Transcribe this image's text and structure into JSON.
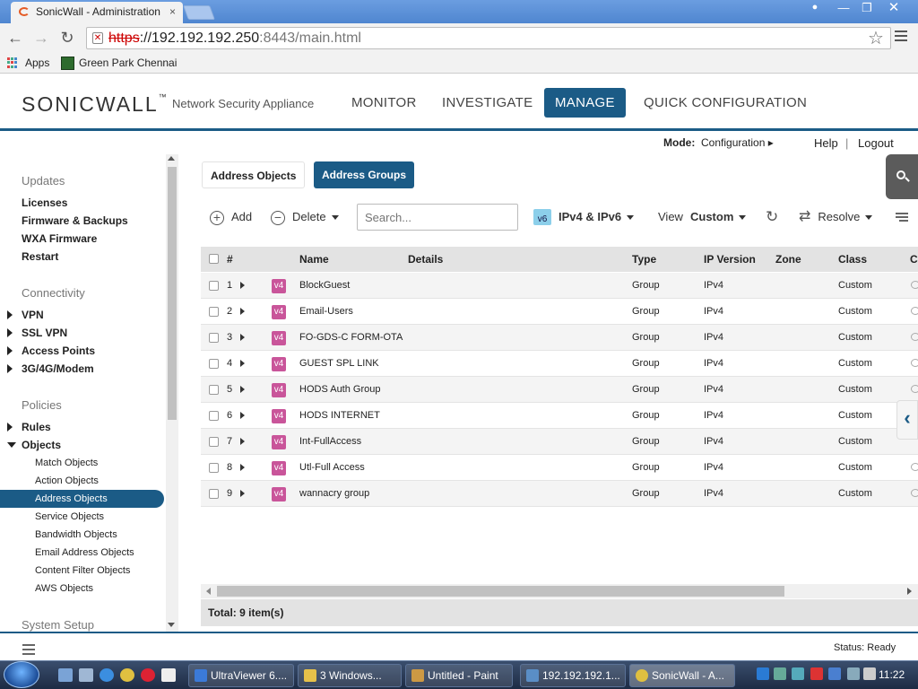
{
  "browser": {
    "tab_title": "SonicWall - Administration",
    "tab_close": "×",
    "url_scheme": "https",
    "url_host": "://192.192.192.250",
    "url_path": ":8443/main.html",
    "bookmarks": [
      {
        "label": "Apps",
        "icon": "apps-grid-icon"
      },
      {
        "label": "Green Park Chennai",
        "icon": "bookmark-favicon"
      }
    ]
  },
  "header": {
    "logo_text": "SONICWALL",
    "logo_tm": "™",
    "tagline": "Network Security Appliance",
    "nav": [
      "MONITOR",
      "INVESTIGATE",
      "MANAGE",
      "QUICK CONFIGURATION"
    ],
    "active_nav": "MANAGE",
    "accent_color": "#1b5b86"
  },
  "modebar": {
    "mode_label": "Mode:",
    "mode_value": "Configuration ▸",
    "help": "Help",
    "separator": "|",
    "logout": "Logout"
  },
  "sidebar": {
    "updates_head": "Updates",
    "updates": [
      "Licenses",
      "Firmware & Backups",
      "WXA Firmware",
      "Restart"
    ],
    "connectivity_head": "Connectivity",
    "connectivity": [
      "VPN",
      "SSL VPN",
      "Access Points",
      "3G/4G/Modem"
    ],
    "policies_head": "Policies",
    "rules": "Rules",
    "objects": "Objects",
    "object_items": [
      "Match Objects",
      "Action Objects",
      "Address Objects",
      "Service Objects",
      "Bandwidth Objects",
      "Email Address Objects",
      "Content Filter Objects",
      "AWS Objects"
    ],
    "selected": "Address Objects",
    "system_head": "System Setup"
  },
  "content": {
    "seg_objects": "Address Objects",
    "seg_groups": "Address Groups",
    "add_label": "Add",
    "delete_label": "Delete",
    "search_placeholder": "Search...",
    "v6_badge": "v6",
    "ip_filter": "IPv4 & IPv6",
    "view_label": "View",
    "view_value": "Custom",
    "resolve_label": "Resolve",
    "columns": [
      "#",
      "Name",
      "Details",
      "Type",
      "IP Version",
      "Zone",
      "Class",
      "Co"
    ],
    "rows": [
      {
        "num": "1",
        "badge": "v4",
        "name": "BlockGuest",
        "type": "Group",
        "ipver": "IPv4",
        "class": "Custom"
      },
      {
        "num": "2",
        "badge": "v4",
        "name": "Email-Users",
        "type": "Group",
        "ipver": "IPv4",
        "class": "Custom"
      },
      {
        "num": "3",
        "badge": "v4",
        "name": "FO-GDS-C FORM-OTA",
        "type": "Group",
        "ipver": "IPv4",
        "class": "Custom"
      },
      {
        "num": "4",
        "badge": "v4",
        "name": "GUEST SPL LINK",
        "type": "Group",
        "ipver": "IPv4",
        "class": "Custom"
      },
      {
        "num": "5",
        "badge": "v4",
        "name": "HODS Auth Group",
        "type": "Group",
        "ipver": "IPv4",
        "class": "Custom"
      },
      {
        "num": "6",
        "badge": "v4",
        "name": "HODS INTERNET",
        "type": "Group",
        "ipver": "IPv4",
        "class": "Custom"
      },
      {
        "num": "7",
        "badge": "v4",
        "name": "Int-FullAccess",
        "type": "Group",
        "ipver": "IPv4",
        "class": "Custom"
      },
      {
        "num": "8",
        "badge": "v4",
        "name": "Utl-Full Access",
        "type": "Group",
        "ipver": "IPv4",
        "class": "Custom"
      },
      {
        "num": "9",
        "badge": "v4",
        "name": "wannacry group",
        "type": "Group",
        "ipver": "IPv4",
        "class": "Custom"
      }
    ],
    "total": "Total: 9 item(s)"
  },
  "footer": {
    "status": "Status: Ready"
  },
  "taskbar": {
    "tasks": [
      "UltraViewer 6....",
      "3 Windows...",
      "Untitled - Paint",
      "192.192.192.1...",
      "SonicWall - A..."
    ],
    "active_task": "SonicWall - A...",
    "clock": "11:22"
  }
}
